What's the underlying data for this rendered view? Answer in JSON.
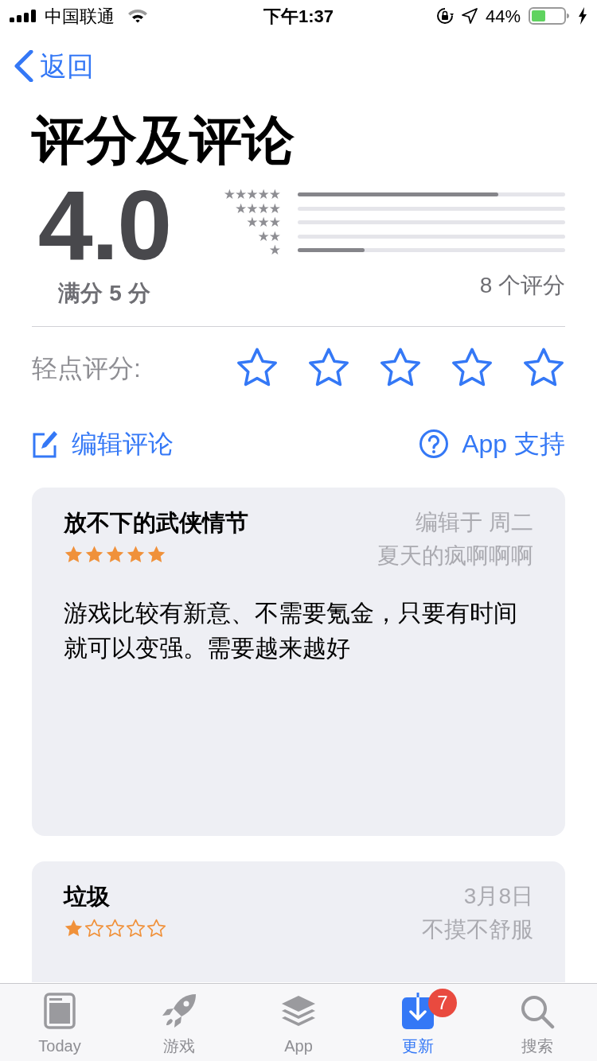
{
  "status_bar": {
    "carrier": "中国联通",
    "time": "下午1:37",
    "battery": "44%"
  },
  "nav": {
    "back": "返回"
  },
  "title": "评分及评论",
  "summary": {
    "average": "4.0",
    "out_of": "满分 5 分",
    "count": "8 个评分",
    "histogram": [
      {
        "label": "★★★★★",
        "level": 0.75
      },
      {
        "label": "★★★★"
      },
      {
        "label": "★★★"
      },
      {
        "label": "★★"
      },
      {
        "label": "★",
        "level": 0.25
      }
    ]
  },
  "tap_to_rate": {
    "label": "轻点评分:",
    "stars": 0
  },
  "actions": [
    {
      "kind": "edit",
      "label": "编辑评论"
    },
    {
      "kind": "help",
      "label": "App 支持"
    }
  ],
  "reviews": [
    {
      "title": "放不下的武侠情节",
      "date": "编辑于 周二",
      "stars": 5,
      "author": "夏天的疯啊啊啊",
      "body": "游戏比较有新意、不需要氪金，只要有时间就可以变强。需要越来越好"
    },
    {
      "title": "垃圾",
      "date": "3月8日",
      "stars": 1,
      "author": "不摸不舒服"
    }
  ],
  "tabs": [
    {
      "kind": "today",
      "label": "Today",
      "selected": false
    },
    {
      "kind": "games",
      "label": "游戏",
      "selected": false
    },
    {
      "kind": "apps",
      "label": "App",
      "selected": false
    },
    {
      "kind": "updates",
      "label": "更新",
      "selected": true,
      "badge": "7"
    },
    {
      "kind": "search",
      "label": "搜索",
      "selected": false
    }
  ]
}
